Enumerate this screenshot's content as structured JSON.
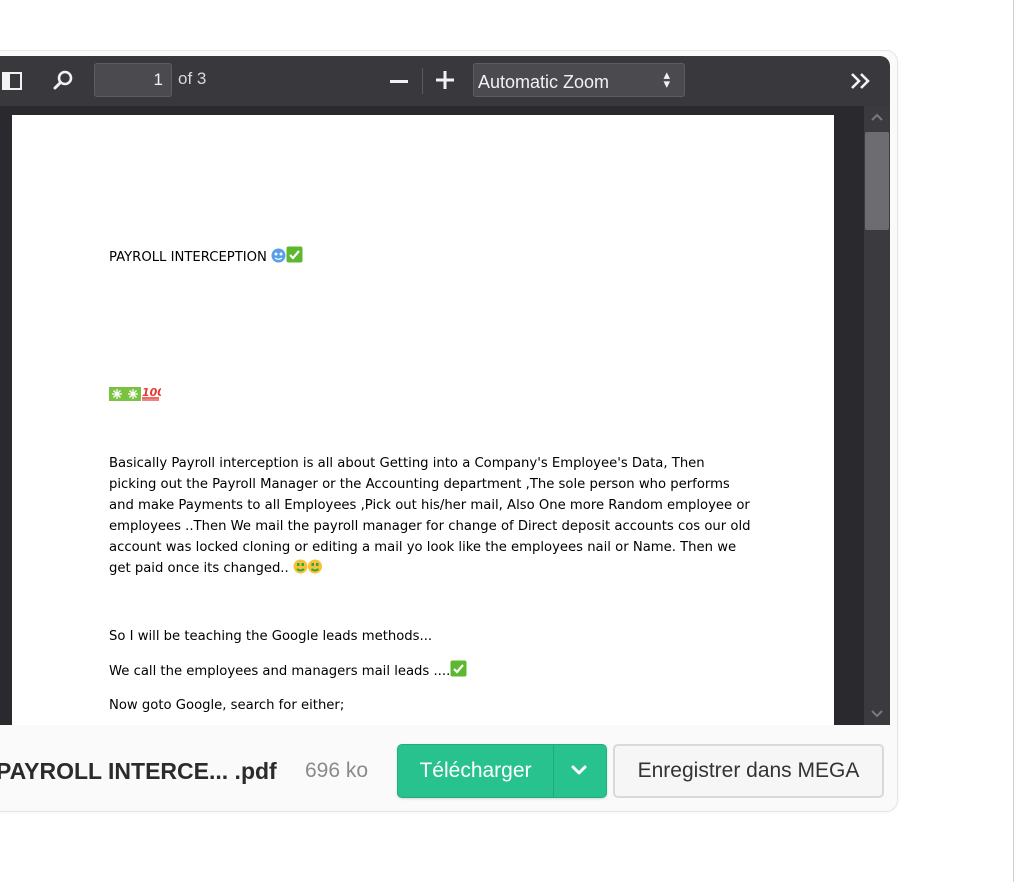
{
  "toolbar": {
    "page_number": "1",
    "page_count_label": "of 3",
    "zoom_value": "Automatic Zoom"
  },
  "document": {
    "title": "PAYROLL INTERCEPTION",
    "paragraph": [
      "Basically Payroll interception is all about Getting into a Company's Employee's Data, Then",
      "picking out the Payroll Manager or the Accounting department ,The sole person who performs",
      "and make Payments to all Employees ,Pick out his/her mail, Also One more Random employee or",
      "employees ..Then We mail the payroll manager for change of Direct deposit accounts  cos our old",
      "account was locked cloning or editing a mail yo look like the employees nail or Name.  Then we",
      "get paid once its changed.."
    ],
    "line_google": "So I will be teaching the  Google leads methods...",
    "line_call": "We call the employees and managers mail leads ....",
    "line_goto": "Now goto Google, search for  either;"
  },
  "footer": {
    "file_name": "PAYROLL INTERCE... .pdf",
    "file_size": "696 ko",
    "download_label": "Télécharger",
    "save_label": "Enregistrer dans MEGA"
  },
  "colors": {
    "toolbar_bg": "#38383d",
    "viewer_bg": "#2a2a2e",
    "download_green": "#27c28e"
  },
  "icons": [
    "sidebar-toggle-icon",
    "search-icon",
    "minus-icon",
    "plus-icon",
    "double-chevron-right-icon",
    "chevron-down-icon",
    "scroll-up-icon",
    "scroll-down-icon",
    "sparkle-emoji-icon",
    "hundred-emoji-icon",
    "check-mark-emoji-icon",
    "money-face-emoji-icon"
  ]
}
